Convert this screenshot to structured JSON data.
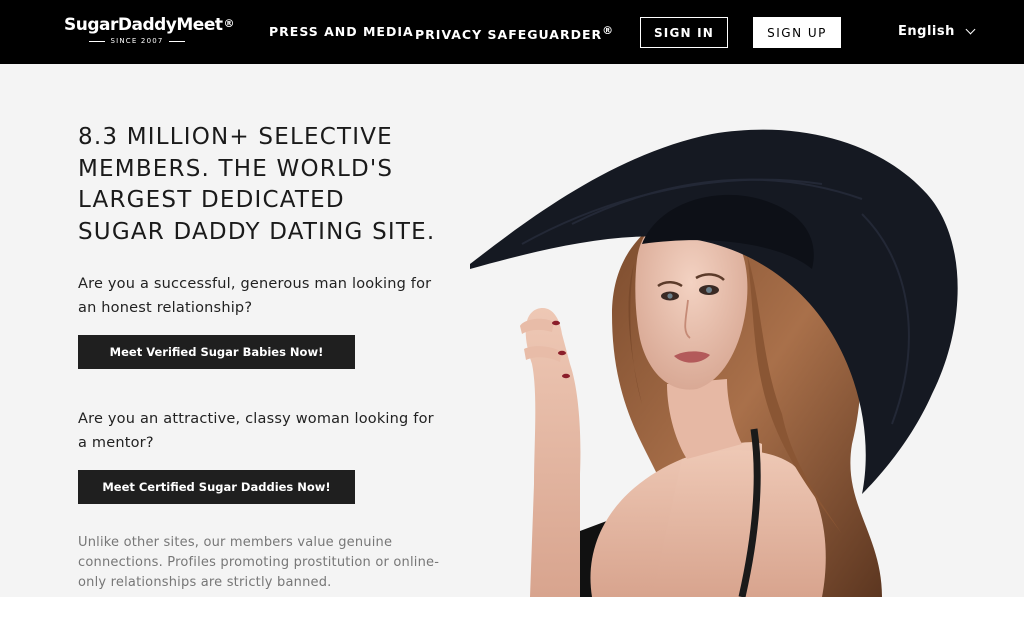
{
  "brand": {
    "name": "SugarDaddyMeet",
    "registered": "®",
    "since": "SINCE 2007"
  },
  "nav": {
    "press": "PRESS AND MEDIA",
    "privacy": "PRIVACY SAFEGUARDER",
    "privacy_reg": "®",
    "sign_in": "SIGN IN",
    "sign_up": "SIGN UP",
    "language": "English"
  },
  "hero": {
    "headline": "8.3 MILLION+ SELECTIVE MEMBERS. THE WORLD'S LARGEST DEDICATED SUGAR DADDY DATING SITE.",
    "question_men": "Are you a successful, generous man looking for an honest relationship?",
    "cta_men": "Meet Verified Sugar Babies Now!",
    "question_women": "Are you an attractive, classy woman looking for a mentor?",
    "cta_women": "Meet Certified Sugar Daddies Now!",
    "note": "Unlike other sites, our members value genuine connections. Profiles promoting prostitution or online-only relationships are strictly banned."
  },
  "colors": {
    "nav_bg": "#000000",
    "hero_bg": "#f4f4f4",
    "cta_bg": "#1f1f1f",
    "note_text": "#777777"
  },
  "icons": {
    "language_dropdown": "chevron-down-icon"
  }
}
